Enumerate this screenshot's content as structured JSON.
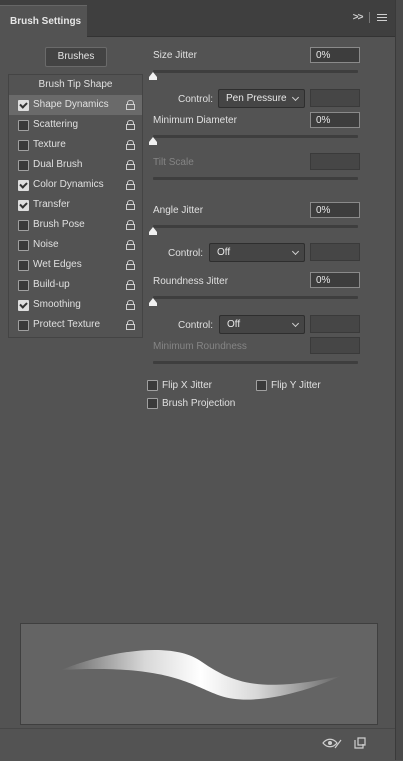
{
  "panel": {
    "title": "Brush Settings",
    "brushes_button": "Brushes"
  },
  "options": {
    "header": "Brush Tip Shape",
    "items": [
      {
        "label": "Shape Dynamics",
        "checked": true,
        "selected": true
      },
      {
        "label": "Scattering",
        "checked": false
      },
      {
        "label": "Texture",
        "checked": false
      },
      {
        "label": "Dual Brush",
        "checked": false
      },
      {
        "label": "Color Dynamics",
        "checked": true
      },
      {
        "label": "Transfer",
        "checked": true
      },
      {
        "label": "Brush Pose",
        "checked": false
      },
      {
        "label": "Noise",
        "checked": false
      },
      {
        "label": "Wet Edges",
        "checked": false
      },
      {
        "label": "Build-up",
        "checked": false
      },
      {
        "label": "Smoothing",
        "checked": true
      },
      {
        "label": "Protect Texture",
        "checked": false
      }
    ]
  },
  "settings": {
    "size_jitter": {
      "label": "Size Jitter",
      "value": "0%"
    },
    "control_1": {
      "label": "Control:",
      "value": "Pen Pressure"
    },
    "min_diameter": {
      "label": "Minimum Diameter",
      "value": "0%"
    },
    "tilt_scale": {
      "label": "Tilt Scale"
    },
    "angle_jitter": {
      "label": "Angle Jitter",
      "value": "0%"
    },
    "control_2": {
      "label": "Control:",
      "value": "Off"
    },
    "roundness_jitter": {
      "label": "Roundness Jitter",
      "value": "0%"
    },
    "control_3": {
      "label": "Control:",
      "value": "Off"
    },
    "min_roundness": {
      "label": "Minimum Roundness"
    },
    "flip_x": {
      "label": "Flip X Jitter",
      "checked": false
    },
    "flip_y": {
      "label": "Flip Y Jitter",
      "checked": false
    },
    "brush_projection": {
      "label": "Brush Projection",
      "checked": false
    }
  },
  "icons": {
    "collapse": ">>",
    "menu": "panel-menu-icon",
    "footer_eye": "toggle-preview-icon",
    "footer_new": "new-brush-icon"
  },
  "colors": {
    "panel_bg": "#535353",
    "selected_row": "#6a6a6a",
    "preview_bg": "#646464"
  }
}
